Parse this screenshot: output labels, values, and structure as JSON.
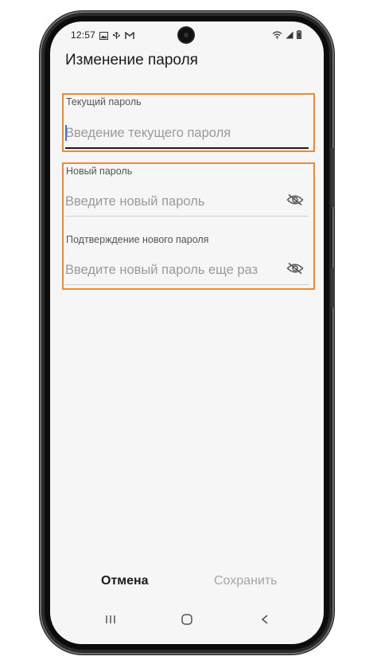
{
  "status_bar": {
    "time": "12:57",
    "icons_left": [
      "gallery-icon",
      "usb-icon",
      "gmail-icon"
    ],
    "icons_right": [
      "wifi-icon",
      "signal-icon",
      "battery-icon"
    ]
  },
  "page": {
    "title": "Изменение пароля"
  },
  "current_password": {
    "label": "Текущий пароль",
    "placeholder": "Введение текущего пароля",
    "value": ""
  },
  "new_password": {
    "label": "Новый пароль",
    "placeholder": "Введите новый пароль",
    "value": ""
  },
  "confirm_password": {
    "label": "Подтверждение нового пароля",
    "placeholder": "Введите новый пароль еще раз",
    "value": ""
  },
  "actions": {
    "cancel_label": "Отмена",
    "save_label": "Сохранить"
  },
  "navigation": {
    "buttons": [
      "recents-icon",
      "home-icon",
      "back-icon"
    ]
  },
  "colors": {
    "highlight": "#f08a2e",
    "cursor": "#3478f6",
    "disabled_text": "#a6a6a6"
  }
}
